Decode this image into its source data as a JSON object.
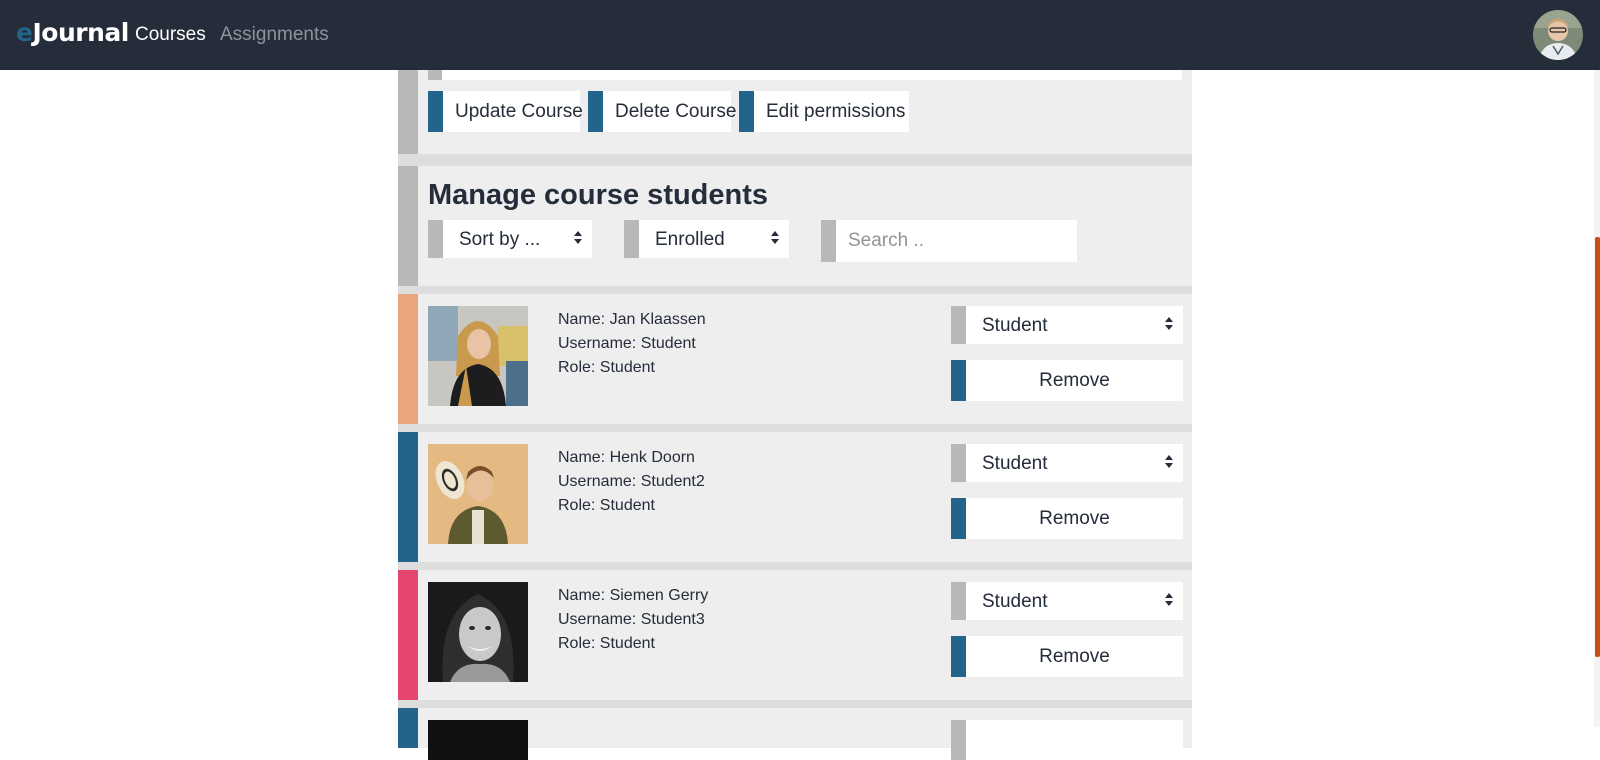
{
  "navbar": {
    "brand_prefix": "e",
    "brand_rest": "Journal",
    "links": [
      "Courses",
      "Assignments"
    ],
    "active_link": "Courses"
  },
  "course_actions": {
    "update_label": "Update Course",
    "delete_label": "Delete Course",
    "permissions_label": "Edit permissions"
  },
  "manage": {
    "title": "Manage course students",
    "sort_select": "Sort by ...",
    "filter_select": "Enrolled",
    "search_placeholder": "Search .."
  },
  "students": [
    {
      "name": "Name: Jan Klaassen",
      "username": "Username: Student",
      "role": "Role: Student",
      "role_select": "Student",
      "remove_label": "Remove",
      "accent_color": "#eaa57f"
    },
    {
      "name": "Name: Henk Doorn",
      "username": "Username: Student2",
      "role": "Role: Student",
      "role_select": "Student",
      "remove_label": "Remove",
      "accent_color": "#22648a"
    },
    {
      "name": "Name: Siemen Gerry",
      "username": "Username: Student3",
      "role": "Role: Student",
      "role_select": "Student",
      "remove_label": "Remove",
      "accent_color": "#e6466e"
    }
  ],
  "colors": {
    "navbar": "#252c3a",
    "brand_accent": "#22648a",
    "button_accent": "#22648a",
    "neutral_accent": "#b8b8b8",
    "card_background": "#eeeeee",
    "scrollbar": "#c64d18"
  },
  "icons": {
    "select_arrows": "sort-arrows-icon",
    "user_avatar": "user-avatar"
  }
}
